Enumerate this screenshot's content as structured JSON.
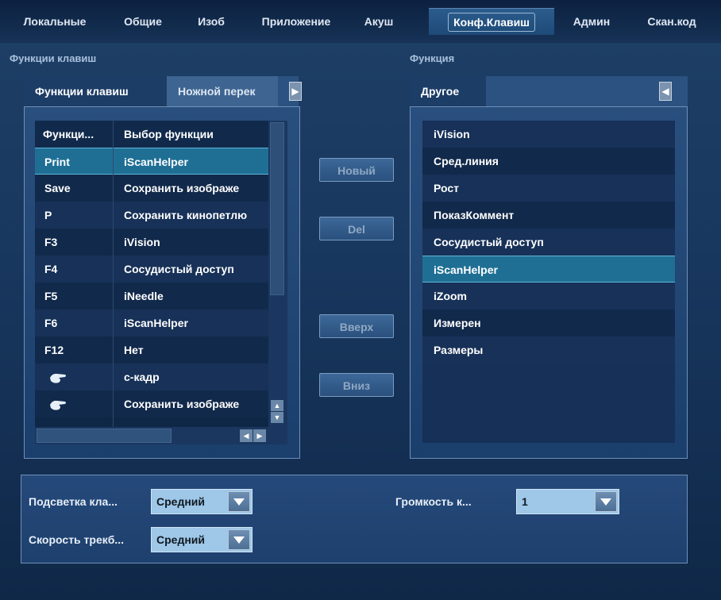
{
  "tabs": [
    {
      "label": "Локальные"
    },
    {
      "label": "Общие"
    },
    {
      "label": "Изоб"
    },
    {
      "label": "Приложение"
    },
    {
      "label": "Акуш"
    },
    {
      "label": "Конф.Клавиш",
      "active": true
    },
    {
      "label": "Админ"
    },
    {
      "label": "Скан.код"
    }
  ],
  "left": {
    "section_title": "Функции клавиш",
    "subtabs": {
      "active": "Функции клавиш",
      "inactive": "Ножной перек"
    },
    "columns": {
      "key": "Функци...",
      "function": "Выбор функции"
    },
    "rows": [
      {
        "key": "Print",
        "function": "iScanHelper",
        "selected": true
      },
      {
        "key": "Save",
        "function": "Сохранить изображе"
      },
      {
        "key": "P",
        "function": "Сохранить кинопетлю"
      },
      {
        "key": "F3",
        "function": "iVision"
      },
      {
        "key": "F4",
        "function": "Сосудистый доступ"
      },
      {
        "key": "F5",
        "function": "iNeedle"
      },
      {
        "key": "F6",
        "function": "iScanHelper"
      },
      {
        "key": "F12",
        "function": "Нет"
      },
      {
        "key_icon": "foot-pedal-left-icon",
        "function": "с-кадр"
      },
      {
        "key_icon": "foot-pedal-middle-icon",
        "function": "Сохранить изображе"
      }
    ]
  },
  "buttons": {
    "new": "Новый",
    "del": "Del",
    "up": "Вверх",
    "down": "Вниз"
  },
  "right": {
    "section_title": "Функция",
    "subtab_active": "Другое",
    "items": [
      {
        "label": "iVision"
      },
      {
        "label": "Сред.линия"
      },
      {
        "label": "Рост"
      },
      {
        "label": "ПоказКоммент"
      },
      {
        "label": "Сосудистый доступ"
      },
      {
        "label": "iScanHelper",
        "selected": true
      },
      {
        "label": "iZoom"
      },
      {
        "label": "Измерен"
      },
      {
        "label": "Размеры"
      }
    ]
  },
  "settings": {
    "backlight": {
      "label": "Подсветка кла...",
      "value": "Средний"
    },
    "trackball": {
      "label": "Скорость трекб...",
      "value": "Средний"
    },
    "volume": {
      "label": "Громкость к...",
      "value": "1"
    }
  },
  "colors": {
    "background": "#1a3a62",
    "selected_row": "#1f6f95",
    "dropdown_bg": "#9ec7e8"
  }
}
